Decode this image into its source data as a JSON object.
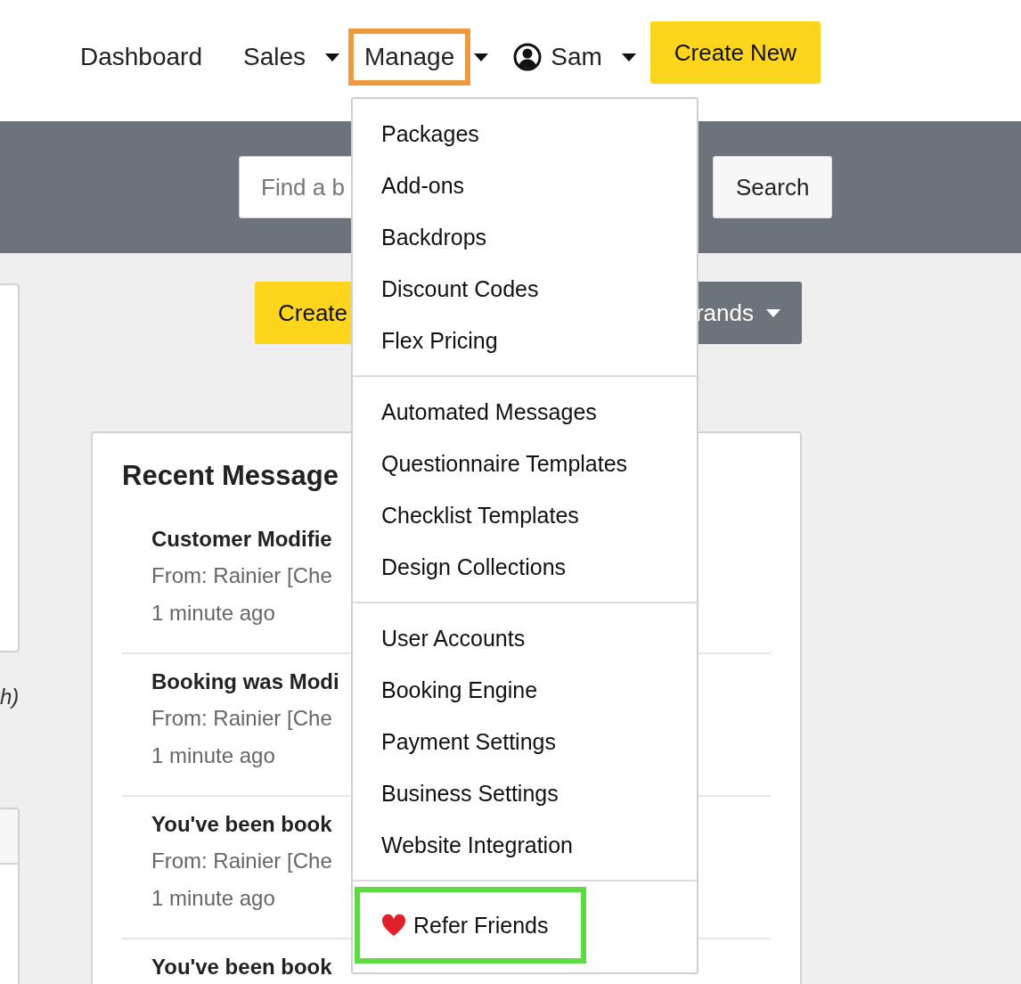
{
  "nav": {
    "items": [
      {
        "label": "Dashboard",
        "kind": "link",
        "highlighted": false
      },
      {
        "label": "Sales",
        "kind": "dropdown",
        "highlighted": false
      },
      {
        "label": "Manage",
        "kind": "dropdown",
        "highlighted": true
      },
      {
        "label": "Sam",
        "kind": "user",
        "highlighted": false
      }
    ],
    "create_button": "Create New"
  },
  "search": {
    "placeholder": "Find a b",
    "button": "Search"
  },
  "left_note": "h)",
  "actions": {
    "create": "Create",
    "brands": "rands"
  },
  "messages_card": {
    "title": "Recent Message",
    "messages": [
      {
        "title": "Customer Modifie",
        "from": "From: Rainier [Che",
        "time": "1 minute ago"
      },
      {
        "title": "Booking was Modi",
        "from": "From: Rainier [Che",
        "time": "1 minute ago"
      },
      {
        "title": "You've been book",
        "from": "From: Rainier [Che",
        "time": "1 minute ago"
      },
      {
        "title": "You've been book"
      }
    ]
  },
  "manage_menu": {
    "groups": [
      {
        "items": [
          {
            "label": "Packages",
            "kind": "plain",
            "highlighted": false
          },
          {
            "label": "Add-ons",
            "kind": "plain",
            "highlighted": false
          },
          {
            "label": "Backdrops",
            "kind": "plain",
            "highlighted": false
          },
          {
            "label": "Discount Codes",
            "kind": "plain",
            "highlighted": false
          },
          {
            "label": "Flex Pricing",
            "kind": "plain",
            "highlighted": false
          }
        ]
      },
      {
        "items": [
          {
            "label": "Automated Messages",
            "kind": "plain",
            "highlighted": false
          },
          {
            "label": "Questionnaire Templates",
            "kind": "plain",
            "highlighted": false
          },
          {
            "label": "Checklist Templates",
            "kind": "plain",
            "highlighted": false
          },
          {
            "label": "Design Collections",
            "kind": "plain",
            "highlighted": false
          }
        ]
      },
      {
        "items": [
          {
            "label": "User Accounts",
            "kind": "plain",
            "highlighted": false
          },
          {
            "label": "Booking Engine",
            "kind": "plain",
            "highlighted": false
          },
          {
            "label": "Payment Settings",
            "kind": "plain",
            "highlighted": false
          },
          {
            "label": "Business Settings",
            "kind": "plain",
            "highlighted": false
          },
          {
            "label": "Website Integration",
            "kind": "plain",
            "highlighted": false
          }
        ]
      },
      {
        "items": [
          {
            "label": "Refer Friends",
            "kind": "referral",
            "highlighted": true
          }
        ]
      }
    ]
  }
}
